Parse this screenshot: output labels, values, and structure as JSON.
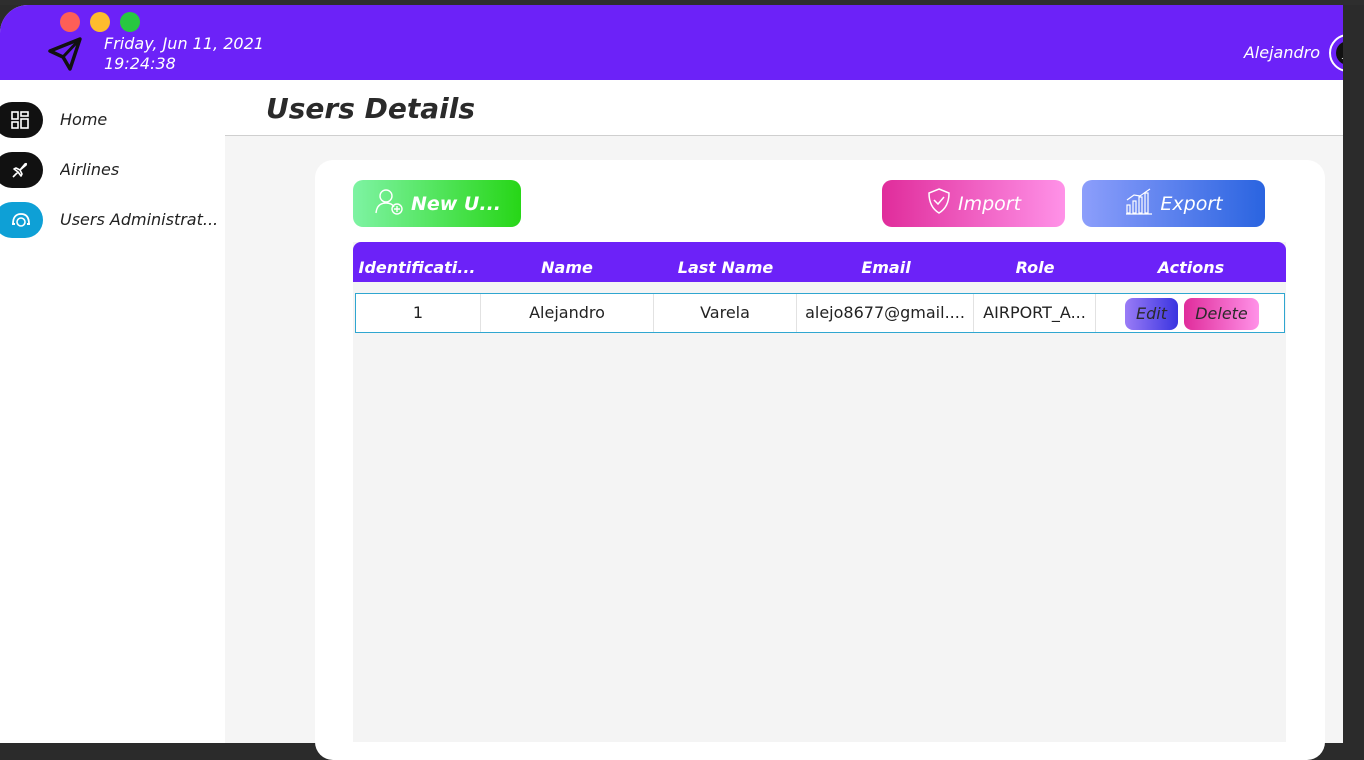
{
  "header": {
    "date": "Friday, Jun 11, 2021",
    "time": "19:24:38",
    "user": "Alejandro",
    "accent": "#6c22f8"
  },
  "sidebar": {
    "items": [
      {
        "label": "Home",
        "icon": "dashboard-icon"
      },
      {
        "label": "Airlines",
        "icon": "airplane-icon"
      },
      {
        "label": "Users Administrat...",
        "icon": "users-admin-icon",
        "active": true
      }
    ]
  },
  "page": {
    "title": "Users Details"
  },
  "toolbar": {
    "new_label": "New U...",
    "import_label": "Import",
    "export_label": "Export"
  },
  "table": {
    "columns": [
      "Identificati...",
      "Name",
      "Last Name",
      "Email",
      "Role",
      "Actions"
    ],
    "rows": [
      [
        "1",
        "Alejandro",
        "Varela",
        "alejo8677@gmail....",
        "AIRPORT_A..."
      ]
    ],
    "edit_label": "Edit",
    "delete_label": "Delete"
  }
}
